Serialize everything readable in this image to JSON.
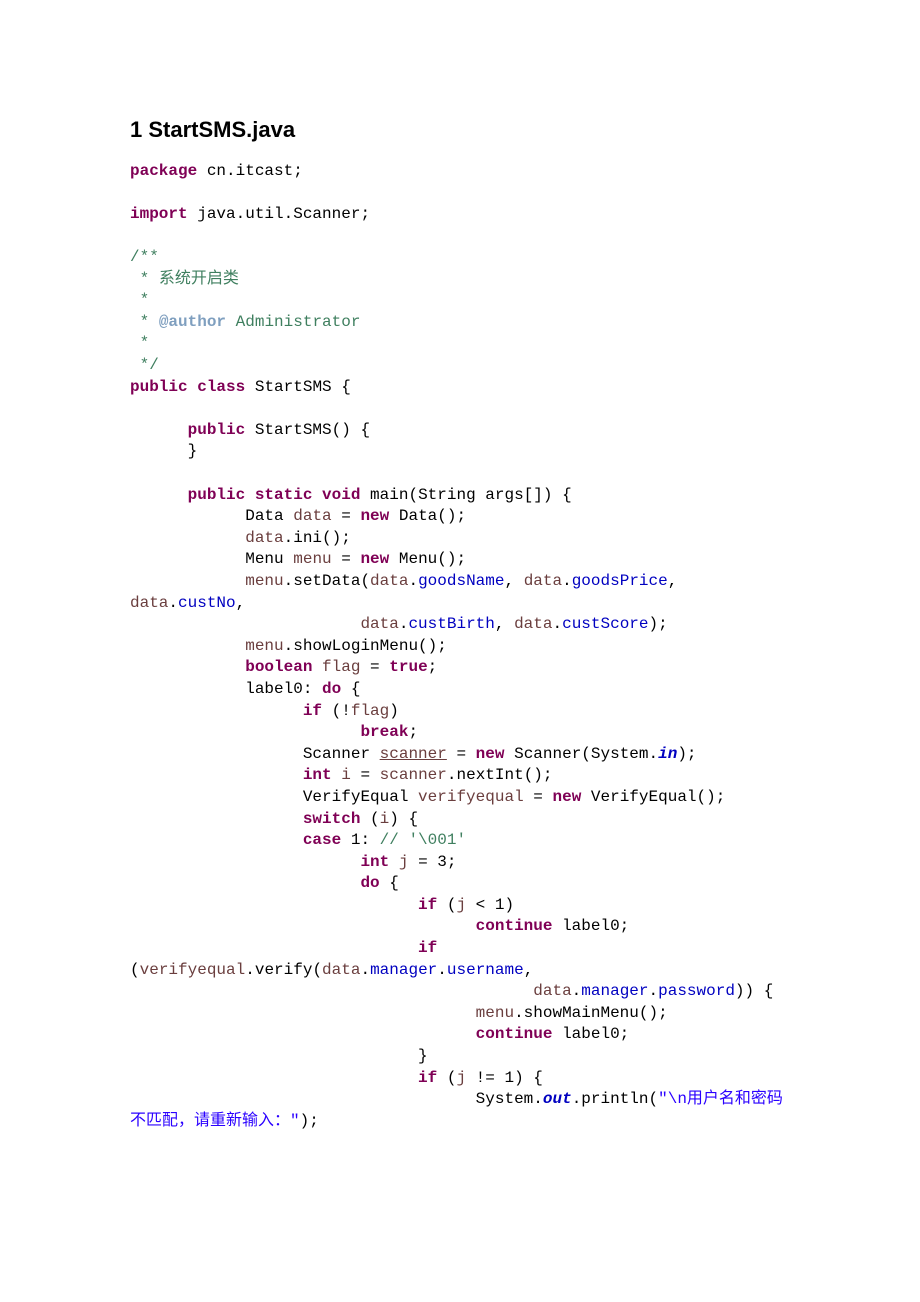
{
  "heading": "1 StartSMS.java",
  "code_html": "<span class=\"kw\">package</span> cn.itcast;\n\n<span class=\"kw\">import</span> java.util.Scanner;\n\n<span class=\"cmt\">/**</span>\n<span class=\"cmt\"> * 系统开启类</span>\n<span class=\"cmt\"> *</span>\n<span class=\"cmt\"> * <span class=\"tag\">@author</span> Administrator</span>\n<span class=\"cmt\"> *</span>\n<span class=\"cmt\"> */</span>\n<span class=\"kw\">public</span> <span class=\"kw\">class</span> StartSMS {\n\n      <span class=\"kw\">public</span> StartSMS() {\n      }\n\n      <span class=\"kw\">public</span> <span class=\"kw\">static</span> <span class=\"kw\">void</span> main(String args[]) {\n            Data <span class=\"lvar\">data</span> = <span class=\"kw\">new</span> Data();\n            <span class=\"lvar\">data</span>.ini();\n            Menu <span class=\"lvar\">menu</span> = <span class=\"kw\">new</span> Menu();\n            <span class=\"lvar\">menu</span>.setData(<span class=\"lvar\">data</span>.<span class=\"fld\">goodsName</span>, <span class=\"lvar\">data</span>.<span class=\"fld\">goodsPrice</span>, <span class=\"lvar\">data</span>.<span class=\"fld\">custNo</span>,\n                        <span class=\"lvar\">data</span>.<span class=\"fld\">custBirth</span>, <span class=\"lvar\">data</span>.<span class=\"fld\">custScore</span>);\n            <span class=\"lvar\">menu</span>.showLoginMenu();\n            <span class=\"kw\">boolean</span> <span class=\"lvar\">flag</span> = <span class=\"kw\">true</span>;\n            label0: <span class=\"kw\">do</span> {\n                  <span class=\"kw\">if</span> (!<span class=\"lvar\">flag</span>)\n                        <span class=\"kw\">break</span>;\n                  Scanner <span class=\"lvar u\">scanner</span> = <span class=\"kw\">new</span> Scanner(System.<span class=\"sfld\">in</span>);\n                  <span class=\"kw\">int</span> <span class=\"lvar\">i</span> = <span class=\"lvar\">scanner</span>.nextInt();\n                  VerifyEqual <span class=\"lvar\">verifyequal</span> = <span class=\"kw\">new</span> VerifyEqual();\n                  <span class=\"kw\">switch</span> (<span class=\"lvar\">i</span>) {\n                  <span class=\"kw\">case</span> 1: <span class=\"cmt\">// '\\001'</span>\n                        <span class=\"kw\">int</span> <span class=\"lvar\">j</span> = 3;\n                        <span class=\"kw\">do</span> {\n                              <span class=\"kw\">if</span> (<span class=\"lvar\">j</span> &lt; 1)\n                                    <span class=\"kw\">continue</span> label0;\n                              <span class=\"kw\">if</span> (<span class=\"lvar\">verifyequal</span>.verify(<span class=\"lvar\">data</span>.<span class=\"fld\">manager</span>.<span class=\"fld\">username</span>,\n                                          <span class=\"lvar\">data</span>.<span class=\"fld\">manager</span>.<span class=\"fld\">password</span>)) {\n                                    <span class=\"lvar\">menu</span>.showMainMenu();\n                                    <span class=\"kw\">continue</span> label0;\n                              }\n                              <span class=\"kw\">if</span> (<span class=\"lvar\">j</span> != 1) {\n                                    System.<span class=\"sfld\">out</span>.println(<span class=\"str\">\"\\n用户名和密码不匹配，请重新输入：\"</span>);"
}
